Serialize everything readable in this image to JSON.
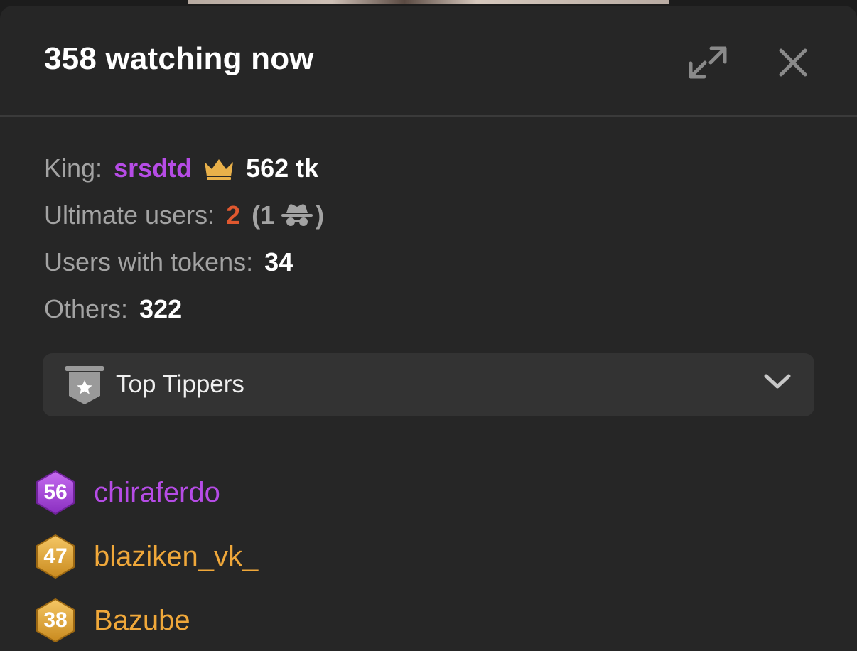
{
  "header": {
    "title": "358 watching now",
    "expand_icon": "expand-icon",
    "close_icon": "close-icon"
  },
  "stats": {
    "king_label": "King:",
    "king_name": "srsdtd",
    "king_amount": "562 tk",
    "ultimate_label": "Ultimate users:",
    "ultimate_count": "2",
    "ultimate_paren_open": "(",
    "ultimate_anon_count": "1",
    "ultimate_paren_close": ")",
    "tokens_label": "Users with tokens:",
    "tokens_count": "34",
    "others_label": "Others:",
    "others_count": "322"
  },
  "dropdown": {
    "label": "Top Tippers",
    "icon": "star-badge-icon"
  },
  "tippers": [
    {
      "level": "56",
      "name": "chiraferdo",
      "color": "#b64ce6",
      "badge": "purple"
    },
    {
      "level": "47",
      "name": "blaziken_vk_",
      "color": "#f0a83a",
      "badge": "gold"
    },
    {
      "level": "38",
      "name": "Bazube",
      "color": "#f0a83a",
      "badge": "gold"
    }
  ],
  "colors": {
    "background": "#262626",
    "king": "#b64ce6",
    "ultimate": "#e0582f",
    "muted": "#a3a3a3",
    "gold": "#f0a83a",
    "purple": "#b64ce6"
  }
}
